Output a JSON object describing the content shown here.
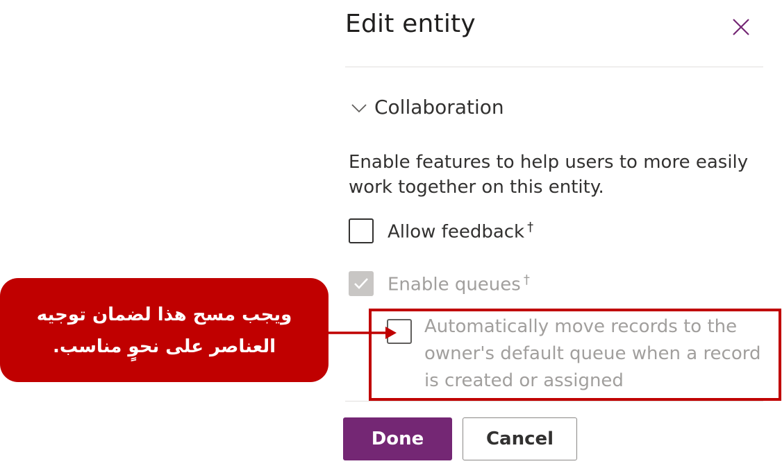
{
  "panel": {
    "title": "Edit entity",
    "close_icon": "close-icon"
  },
  "section": {
    "title": "Collaboration",
    "icon": "chevron-down-icon",
    "description": "Enable features to help users to more easily work together on this entity."
  },
  "options": {
    "allow_feedback": {
      "label": "Allow feedback",
      "marker": "†",
      "checked": false
    },
    "enable_queues": {
      "label": "Enable queues",
      "marker": "†",
      "checked": true,
      "disabled": true
    },
    "auto_move": {
      "label": "Automatically move records to the owner's default queue when a record is created or assigned",
      "checked": false,
      "disabled": true
    }
  },
  "buttons": {
    "done_label": "Done",
    "cancel_label": "Cancel"
  },
  "annotation": {
    "callout_text": "ويجب مسح هذا لضمان توجيه العناصر على نحوٍ مناسب.",
    "color": "#c00000"
  },
  "colors": {
    "accent": "#742774",
    "text": "#323130",
    "disabled_text": "#a19f9d"
  }
}
